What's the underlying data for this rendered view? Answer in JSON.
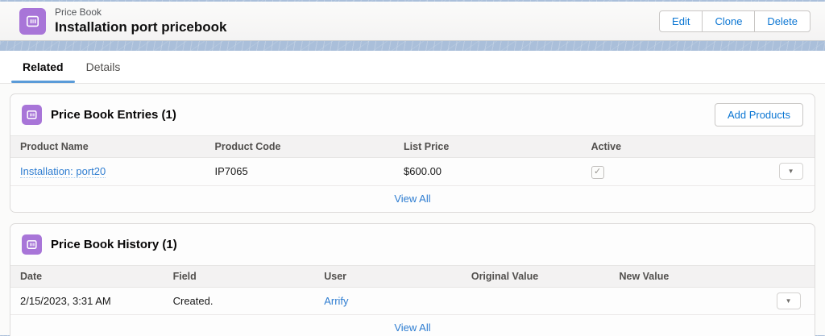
{
  "colors": {
    "brand_blue": "#0b76d3",
    "link_blue": "#2e7dd1",
    "pricebook_purple": "#a875d8",
    "tab_underline": "#5a9bd8",
    "pattern_strip": "#aabfda"
  },
  "icons": {
    "pricebook": "pricebook-icon",
    "dropdown_arrow": "▼",
    "check": "✓"
  },
  "header": {
    "entity_label": "Price Book",
    "title": "Installation port pricebook",
    "actions": {
      "edit": "Edit",
      "clone": "Clone",
      "delete": "Delete"
    }
  },
  "tabs": {
    "related": "Related",
    "details": "Details"
  },
  "entries": {
    "title": "Price Book Entries (1)",
    "add_button": "Add Products",
    "columns": [
      "Product Name",
      "Product Code",
      "List Price",
      "Active"
    ],
    "row": {
      "product_name": "Installation: port20",
      "product_code": "IP7065",
      "list_price": "$600.00",
      "active_checked": true
    },
    "view_all": "View All"
  },
  "history": {
    "title": "Price Book History (1)",
    "columns": [
      "Date",
      "Field",
      "User",
      "Original Value",
      "New Value"
    ],
    "row": {
      "date": "2/15/2023, 3:31 AM",
      "field": "Created.",
      "user": "Arrify",
      "original_value": "",
      "new_value": ""
    },
    "view_all": "View All"
  }
}
